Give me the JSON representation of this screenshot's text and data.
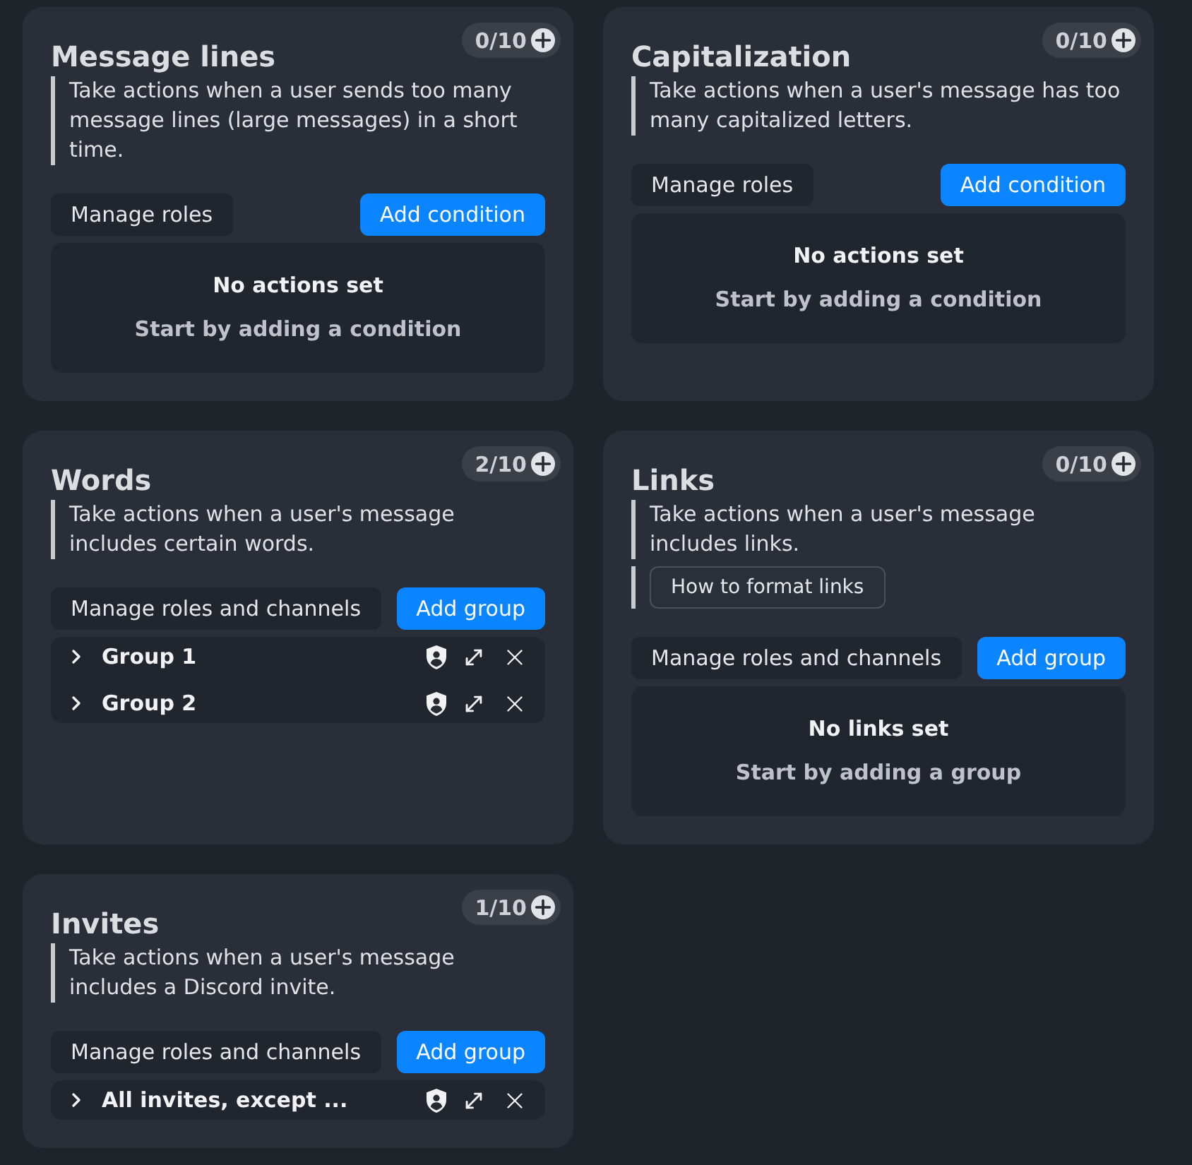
{
  "cards": [
    {
      "title": "Message lines",
      "count": "0/10",
      "description": "Take actions when a user sends too many message lines (large messages) in a short time.",
      "actions": [
        {
          "label": "Manage roles",
          "kind": "secondary"
        },
        {
          "label": "Add condition",
          "kind": "primary"
        }
      ],
      "empty_state": {
        "heading": "No actions set",
        "hint": "Start by adding a condition"
      }
    },
    {
      "title": "Capitalization",
      "count": "0/10",
      "description": "Take actions when a user's message has too many capitalized letters.",
      "actions": [
        {
          "label": "Manage roles",
          "kind": "secondary"
        },
        {
          "label": "Add condition",
          "kind": "primary"
        }
      ],
      "empty_state": {
        "heading": "No actions set",
        "hint": "Start by adding a condition"
      }
    },
    {
      "title": "Words",
      "count": "2/10",
      "description": "Take actions when a user's message includes certain words.",
      "actions": [
        {
          "label": "Manage roles and channels",
          "kind": "secondary"
        },
        {
          "label": "Add group",
          "kind": "primary"
        }
      ],
      "groups": [
        {
          "name": "Group 1",
          "expanded": false
        },
        {
          "name": "Group 2",
          "expanded": false
        }
      ]
    },
    {
      "title": "Links",
      "count": "0/10",
      "description": "Take actions when a user's message includes links.",
      "help_button": "How to format links",
      "actions": [
        {
          "label": "Manage roles and channels",
          "kind": "secondary"
        },
        {
          "label": "Add group",
          "kind": "primary"
        }
      ],
      "empty_state": {
        "heading": "No links set",
        "hint": "Start by adding a group"
      }
    },
    {
      "title": "Invites",
      "count": "1/10",
      "description": "Take actions when a user's message includes a Discord invite.",
      "actions": [
        {
          "label": "Manage roles and channels",
          "kind": "secondary"
        },
        {
          "label": "Add group",
          "kind": "primary"
        }
      ],
      "groups": [
        {
          "name": "All invites, except ...",
          "expanded": false
        }
      ]
    }
  ]
}
